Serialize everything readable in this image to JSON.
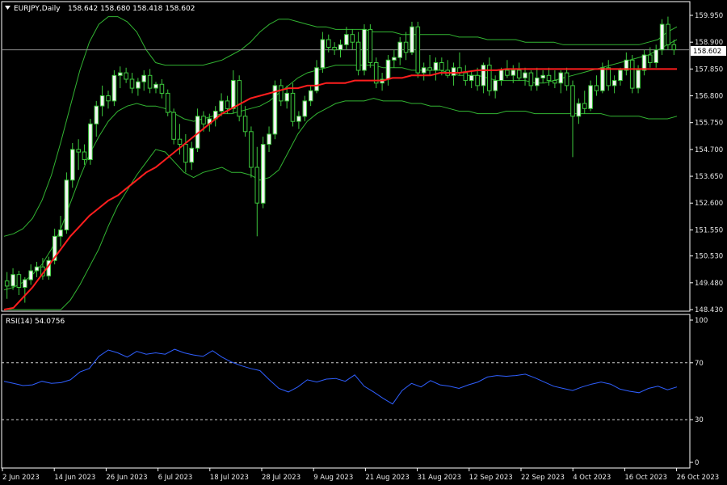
{
  "header": {
    "symbol_label": "EURJPY,Daily",
    "ohlc_label": "158.642 158.680 158.418 158.602",
    "rsi_label": "RSI(14) 54.0756"
  },
  "last_price": "158.602",
  "colors": {
    "background": "#000000",
    "candle_bull": "#f4f4f4",
    "candle_bear": "#000000",
    "wick": "#3cc83c",
    "bollinger": "#32b432",
    "ma": "#ff1e1e",
    "rsi": "#2f5fff",
    "frame": "#ffffff",
    "price_line": "#8c8c8c"
  },
  "chart_data": [
    {
      "type": "candlestick",
      "symbol": "EURJPY",
      "timeframe": "Daily",
      "ylim": [
        148.43,
        159.95
      ],
      "y_ticks": [
        "159.950",
        "158.900",
        "157.850",
        "156.800",
        "155.750",
        "154.700",
        "153.650",
        "152.600",
        "151.550",
        "150.530",
        "149.480",
        "148.430"
      ],
      "x_ticks": [
        "2 Jun 2023",
        "14 Jun 2023",
        "26 Jun 2023",
        "6 Jul 2023",
        "18 Jul 2023",
        "28 Jul 2023",
        "9 Aug 2023",
        "21 Aug 2023",
        "31 Aug 2023",
        "12 Sep 2023",
        "22 Sep 2023",
        "4 Oct 2023",
        "16 Oct 2023",
        "26 Oct 2023"
      ],
      "indicators": [
        "Bollinger Bands",
        "Moving Average (red)"
      ],
      "ohlc": [
        [
          149.55,
          149.9,
          148.85,
          149.35
        ],
        [
          149.35,
          150.05,
          149.2,
          149.8
        ],
        [
          149.8,
          149.95,
          149.0,
          149.3
        ],
        [
          149.3,
          149.7,
          148.7,
          149.6
        ],
        [
          149.6,
          150.2,
          149.4,
          149.95
        ],
        [
          149.95,
          150.3,
          149.7,
          150.1
        ],
        [
          150.1,
          150.45,
          149.6,
          149.75
        ],
        [
          149.75,
          150.5,
          149.6,
          150.35
        ],
        [
          150.35,
          151.6,
          150.2,
          151.3
        ],
        [
          151.3,
          152.1,
          150.9,
          151.55
        ],
        [
          151.55,
          153.8,
          151.4,
          153.5
        ],
        [
          153.5,
          154.95,
          153.2,
          154.7
        ],
        [
          154.7,
          155.1,
          153.9,
          154.6
        ],
        [
          154.6,
          154.9,
          154.1,
          154.3
        ],
        [
          154.3,
          155.9,
          154.1,
          155.7
        ],
        [
          155.7,
          156.6,
          155.2,
          156.4
        ],
        [
          156.4,
          157.2,
          156.0,
          156.8
        ],
        [
          156.8,
          157.0,
          156.3,
          156.6
        ],
        [
          156.6,
          157.8,
          156.4,
          157.6
        ],
        [
          157.6,
          157.95,
          157.1,
          157.7
        ],
        [
          157.7,
          157.9,
          157.3,
          157.45
        ],
        [
          157.45,
          157.7,
          156.9,
          157.1
        ],
        [
          157.1,
          157.5,
          156.8,
          157.35
        ],
        [
          157.35,
          157.8,
          157.0,
          157.6
        ],
        [
          157.6,
          157.85,
          156.9,
          157.1
        ],
        [
          157.1,
          157.35,
          156.9,
          157.25
        ],
        [
          157.25,
          157.45,
          156.7,
          156.9
        ],
        [
          156.9,
          157.05,
          156.0,
          156.15
        ],
        [
          156.15,
          156.3,
          154.9,
          155.1
        ],
        [
          155.1,
          155.7,
          154.5,
          154.9
        ],
        [
          154.9,
          155.3,
          153.8,
          154.2
        ],
        [
          154.2,
          155.0,
          153.9,
          154.75
        ],
        [
          154.75,
          156.3,
          154.6,
          156.0
        ],
        [
          156.0,
          156.2,
          155.4,
          155.7
        ],
        [
          155.7,
          156.1,
          155.4,
          155.9
        ],
        [
          155.9,
          156.4,
          155.6,
          156.2
        ],
        [
          156.2,
          156.9,
          156.0,
          156.6
        ],
        [
          156.6,
          156.8,
          156.1,
          156.3
        ],
        [
          156.3,
          157.8,
          156.1,
          157.4
        ],
        [
          157.4,
          157.6,
          155.8,
          156.0
        ],
        [
          156.0,
          156.4,
          155.2,
          155.4
        ],
        [
          155.4,
          155.6,
          153.6,
          154.0
        ],
        [
          154.0,
          154.8,
          151.3,
          152.6
        ],
        [
          152.6,
          155.2,
          152.4,
          154.9
        ],
        [
          154.9,
          155.6,
          154.6,
          155.3
        ],
        [
          155.3,
          157.4,
          155.1,
          157.2
        ],
        [
          157.2,
          157.45,
          156.4,
          156.6
        ],
        [
          156.6,
          157.2,
          156.3,
          156.9
        ],
        [
          156.9,
          157.3,
          155.6,
          155.8
        ],
        [
          155.8,
          156.2,
          155.5,
          156.0
        ],
        [
          156.0,
          156.8,
          155.8,
          156.6
        ],
        [
          156.6,
          157.2,
          156.4,
          157.0
        ],
        [
          157.0,
          158.2,
          156.9,
          157.9
        ],
        [
          157.9,
          159.3,
          157.7,
          159.0
        ],
        [
          159.0,
          159.2,
          158.5,
          158.7
        ],
        [
          158.7,
          158.9,
          158.4,
          158.6
        ],
        [
          158.6,
          159.0,
          158.3,
          158.8
        ],
        [
          158.8,
          159.5,
          158.6,
          159.2
        ],
        [
          159.2,
          159.4,
          158.6,
          158.9
        ],
        [
          158.9,
          159.3,
          157.6,
          157.8
        ],
        [
          157.8,
          159.6,
          157.6,
          159.4
        ],
        [
          159.4,
          159.6,
          157.9,
          158.1
        ],
        [
          158.1,
          158.3,
          157.1,
          157.3
        ],
        [
          157.3,
          157.7,
          157.0,
          157.45
        ],
        [
          157.45,
          158.4,
          157.2,
          158.2
        ],
        [
          158.2,
          158.6,
          157.9,
          158.3
        ],
        [
          158.3,
          159.1,
          158.0,
          158.9
        ],
        [
          158.9,
          159.3,
          158.2,
          158.5
        ],
        [
          158.5,
          159.7,
          158.4,
          159.5
        ],
        [
          159.5,
          159.7,
          157.5,
          157.7
        ],
        [
          157.7,
          158.1,
          157.4,
          157.9
        ],
        [
          157.9,
          158.4,
          157.6,
          157.8
        ],
        [
          157.8,
          158.3,
          157.4,
          158.1
        ],
        [
          158.1,
          158.3,
          157.6,
          157.8
        ],
        [
          157.8,
          158.2,
          157.5,
          157.6
        ],
        [
          157.6,
          158.1,
          157.2,
          157.9
        ],
        [
          157.9,
          158.5,
          157.6,
          157.7
        ],
        [
          157.7,
          158.0,
          157.2,
          157.4
        ],
        [
          157.4,
          157.8,
          157.1,
          157.6
        ],
        [
          157.6,
          157.9,
          157.0,
          157.2
        ],
        [
          157.2,
          158.1,
          156.9,
          158.0
        ],
        [
          158.0,
          158.3,
          156.8,
          157.0
        ],
        [
          157.0,
          157.6,
          156.7,
          157.4
        ],
        [
          157.4,
          157.9,
          157.2,
          157.8
        ],
        [
          157.8,
          158.2,
          157.5,
          157.6
        ],
        [
          157.6,
          158.0,
          157.3,
          157.8
        ],
        [
          157.8,
          158.1,
          157.4,
          157.5
        ],
        [
          157.5,
          157.9,
          157.2,
          157.7
        ],
        [
          157.7,
          157.8,
          157.0,
          157.2
        ],
        [
          157.2,
          157.9,
          157.0,
          157.5
        ],
        [
          157.5,
          157.8,
          157.3,
          157.6
        ],
        [
          157.6,
          157.9,
          157.2,
          157.4
        ],
        [
          157.4,
          157.8,
          157.1,
          157.3
        ],
        [
          157.3,
          157.8,
          156.9,
          157.7
        ],
        [
          157.7,
          157.9,
          157.0,
          157.2
        ],
        [
          157.2,
          157.4,
          154.4,
          156.0
        ],
        [
          156.0,
          156.7,
          155.7,
          156.5
        ],
        [
          156.5,
          157.0,
          156.1,
          156.3
        ],
        [
          156.3,
          157.4,
          156.2,
          157.2
        ],
        [
          157.2,
          157.6,
          156.8,
          157.0
        ],
        [
          157.0,
          158.1,
          156.9,
          157.9
        ],
        [
          157.9,
          158.2,
          157.0,
          157.2
        ],
        [
          157.2,
          157.6,
          156.9,
          157.4
        ],
        [
          157.4,
          157.9,
          157.2,
          157.8
        ],
        [
          157.8,
          158.5,
          157.6,
          158.2
        ],
        [
          158.2,
          158.4,
          156.9,
          157.1
        ],
        [
          157.1,
          158.0,
          156.9,
          157.8
        ],
        [
          157.8,
          158.6,
          157.6,
          158.4
        ],
        [
          158.4,
          158.7,
          157.9,
          158.1
        ],
        [
          158.1,
          158.8,
          157.9,
          158.6
        ],
        [
          158.6,
          159.8,
          158.4,
          159.6
        ],
        [
          159.6,
          159.9,
          158.6,
          158.8
        ],
        [
          158.8,
          159.0,
          158.4,
          158.6
        ]
      ],
      "bollinger_upper": [
        151.3,
        151.4,
        151.6,
        152.0,
        152.7,
        153.7,
        155.0,
        156.4,
        157.8,
        158.9,
        159.6,
        159.9,
        159.9,
        159.7,
        159.3,
        158.6,
        158.1,
        158.0,
        158.0,
        158.0,
        158.0,
        158.0,
        158.1,
        158.2,
        158.4,
        158.6,
        158.9,
        159.3,
        159.6,
        159.8,
        159.8,
        159.7,
        159.6,
        159.5,
        159.5,
        159.4,
        159.4,
        159.4,
        159.4,
        159.3,
        159.3,
        159.3,
        159.2,
        159.2,
        159.2,
        159.2,
        159.2,
        159.2,
        159.1,
        159.1,
        159.1,
        159.0,
        159.0,
        159.0,
        159.0,
        158.9,
        158.9,
        158.9,
        158.9,
        158.8,
        158.8,
        158.8,
        158.8,
        158.8,
        158.8,
        158.8,
        158.8,
        158.8,
        158.9,
        159.0,
        159.3,
        159.5
      ],
      "bollinger_middle": [
        149.2,
        149.3,
        149.5,
        149.8,
        150.2,
        150.8,
        151.6,
        152.6,
        153.6,
        154.5,
        155.2,
        155.8,
        156.2,
        156.4,
        156.5,
        156.4,
        156.4,
        156.3,
        156.1,
        155.9,
        155.8,
        155.9,
        156.0,
        156.1,
        156.1,
        156.2,
        156.3,
        156.4,
        156.6,
        156.9,
        157.2,
        157.5,
        157.7,
        157.8,
        157.9,
        158.0,
        158.0,
        158.0,
        158.0,
        158.0,
        157.9,
        157.9,
        157.9,
        157.8,
        157.8,
        157.8,
        157.8,
        157.7,
        157.6,
        157.6,
        157.6,
        157.5,
        157.4,
        157.4,
        157.4,
        157.4,
        157.3,
        157.3,
        157.4,
        157.5,
        157.6,
        157.7,
        157.8,
        157.9,
        158.0,
        158.1,
        158.2,
        158.3,
        158.4,
        158.6,
        158.8,
        159.0
      ],
      "bollinger_lower": [
        147.1,
        147.2,
        147.4,
        147.6,
        147.7,
        147.9,
        148.2,
        148.8,
        149.4,
        150.1,
        150.8,
        151.7,
        152.5,
        153.1,
        153.7,
        154.2,
        154.7,
        154.6,
        154.2,
        153.8,
        153.6,
        153.8,
        153.9,
        154.0,
        153.8,
        153.8,
        153.7,
        153.5,
        153.6,
        153.9,
        154.6,
        155.3,
        155.8,
        156.1,
        156.3,
        156.5,
        156.6,
        156.6,
        156.6,
        156.7,
        156.6,
        156.6,
        156.6,
        156.5,
        156.5,
        156.4,
        156.4,
        156.3,
        156.2,
        156.2,
        156.1,
        156.1,
        156.1,
        156.2,
        156.2,
        156.2,
        156.1,
        156.1,
        156.1,
        156.1,
        156.1,
        156.1,
        156.1,
        156.1,
        156.0,
        156.0,
        156.0,
        156.0,
        155.9,
        155.9,
        155.9,
        156.0
      ],
      "moving_average": [
        148.2,
        148.5,
        148.9,
        149.3,
        149.8,
        150.3,
        150.8,
        151.3,
        151.7,
        152.1,
        152.4,
        152.7,
        152.9,
        153.2,
        153.5,
        153.8,
        154.0,
        154.3,
        154.6,
        154.9,
        155.2,
        155.5,
        155.8,
        156.1,
        156.3,
        156.5,
        156.7,
        156.8,
        156.9,
        157.0,
        157.1,
        157.1,
        157.2,
        157.2,
        157.3,
        157.3,
        157.3,
        157.4,
        157.4,
        157.4,
        157.4,
        157.5,
        157.5,
        157.6,
        157.6,
        157.6,
        157.7,
        157.7,
        157.7,
        157.75,
        157.8,
        157.8,
        157.8,
        157.85,
        157.85,
        157.85,
        157.85,
        157.85,
        157.85,
        157.85,
        157.85,
        157.85,
        157.85,
        157.85,
        157.85,
        157.85,
        157.85,
        157.85,
        157.85,
        157.85,
        157.85,
        157.85
      ]
    },
    {
      "type": "line",
      "title": "RSI(14) 54.0756",
      "ylim": [
        0,
        100
      ],
      "y_ticks": [
        "100",
        "70",
        "30",
        "0"
      ],
      "reference_lines": [
        70,
        30
      ],
      "series": [
        {
          "values": [
            57.0,
            55.5,
            54.0,
            54.5,
            57.0,
            55.5,
            56.0,
            58.0,
            63.5,
            66.0,
            74.5,
            79.0,
            77.0,
            74.0,
            78.0,
            76.0,
            77.0,
            76.0,
            79.5,
            77.0,
            75.5,
            74.5,
            78.5,
            74.0,
            70.5,
            68.0,
            66.0,
            64.5,
            58.0,
            52.0,
            49.5,
            53.0,
            58.0,
            56.5,
            58.5,
            59.0,
            57.0,
            61.5,
            53.5,
            49.5,
            45.0,
            41.0,
            50.5,
            55.5,
            53.0,
            57.5,
            54.5,
            53.5,
            52.0,
            54.5,
            56.5,
            60.0,
            61.0,
            60.5,
            61.0,
            62.0,
            59.5,
            56.5,
            53.5,
            52.0,
            50.5,
            53.0,
            55.0,
            56.5,
            55.0,
            51.5,
            50.0,
            49.0,
            52.0,
            53.5,
            51.0,
            53.0
          ]
        }
      ]
    }
  ]
}
